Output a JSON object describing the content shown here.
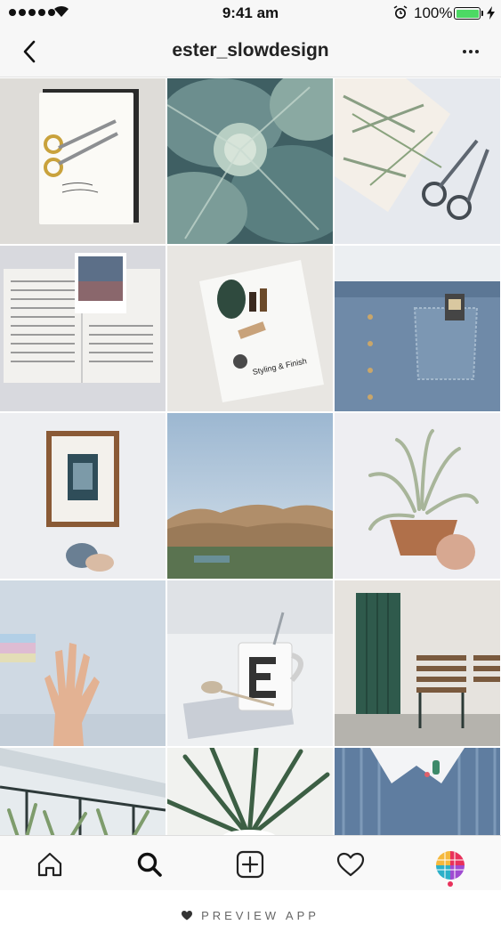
{
  "status_bar": {
    "time": "9:41 am",
    "battery_percent": "100%",
    "battery_level": 1.0,
    "signal_bars": 5,
    "icons": [
      "signal-icon",
      "wifi-icon",
      "alarm-icon",
      "battery-icon",
      "charging-icon"
    ]
  },
  "nav": {
    "title": "ester_slowdesign",
    "back_icon": "chevron-left-icon",
    "more_icon": "more-dots-icon"
  },
  "grid": {
    "columns": 3,
    "posts": [
      {
        "subject": "notebook with gold scissors"
      },
      {
        "subject": "cabbage leaves"
      },
      {
        "subject": "rosemary and scissors"
      },
      {
        "subject": "open book with polaroid"
      },
      {
        "subject": "Styling & Finish magazine"
      },
      {
        "subject": "denim pocket"
      },
      {
        "subject": "framed print on wall"
      },
      {
        "subject": "hills landscape"
      },
      {
        "subject": "air plant in pot"
      },
      {
        "subject": "hand with rainbow light"
      },
      {
        "subject": "mug with letter E"
      },
      {
        "subject": "green door and benches"
      },
      {
        "subject": "balcony plants"
      },
      {
        "subject": "palm leaves"
      },
      {
        "subject": "striped shirt with cactus pin"
      }
    ]
  },
  "tab_bar": {
    "items": [
      {
        "icon": "home-icon"
      },
      {
        "icon": "search-icon"
      },
      {
        "icon": "add-post-icon"
      },
      {
        "icon": "heart-icon"
      },
      {
        "icon": "profile-avatar"
      }
    ],
    "active_color": "#e8315b"
  },
  "footer": {
    "label": "PREVIEW APP",
    "icon": "heart-icon"
  },
  "colors": {
    "bar_background": "#f7f7f7",
    "battery_green": "#4cd964"
  }
}
